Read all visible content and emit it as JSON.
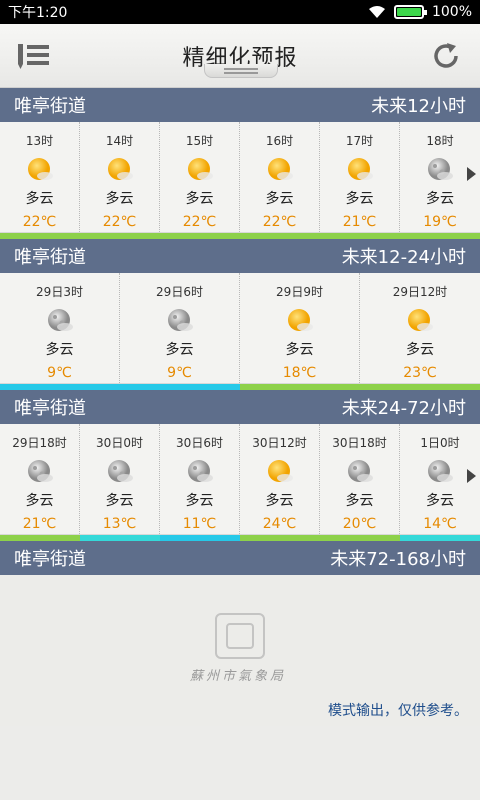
{
  "status_bar": {
    "time": "下午1:20",
    "battery": "100%",
    "battery_level": 1.0
  },
  "header": {
    "title": "精细化预报",
    "menu_icon": "list-menu-icon",
    "refresh_icon": "refresh-icon"
  },
  "sections": [
    {
      "location": "唯亭街道",
      "range": "未来12小时",
      "items": [
        {
          "time": "13时",
          "icon": "sunny-icon",
          "desc": "多云",
          "temp": "22℃"
        },
        {
          "time": "14时",
          "icon": "sunny-icon",
          "desc": "多云",
          "temp": "22℃"
        },
        {
          "time": "15时",
          "icon": "sunny-icon",
          "desc": "多云",
          "temp": "22℃"
        },
        {
          "time": "16时",
          "icon": "sunny-icon",
          "desc": "多云",
          "temp": "22℃"
        },
        {
          "time": "17时",
          "icon": "sunny-icon",
          "desc": "多云",
          "temp": "21℃"
        },
        {
          "time": "18时",
          "icon": "moon-icon",
          "desc": "多云",
          "temp": "19℃"
        }
      ],
      "bar_colors": [
        "#8dd14a",
        "#8dd14a",
        "#8dd14a",
        "#8dd14a",
        "#8dd14a",
        "#8dd14a"
      ]
    },
    {
      "location": "唯亭街道",
      "range": "未来12-24小时",
      "items": [
        {
          "time": "29日3时",
          "icon": "moon-icon",
          "desc": "多云",
          "temp": "9℃"
        },
        {
          "time": "29日6时",
          "icon": "moon-icon",
          "desc": "多云",
          "temp": "9℃"
        },
        {
          "time": "29日9时",
          "icon": "sunny-icon",
          "desc": "多云",
          "temp": "18℃"
        },
        {
          "time": "29日12时",
          "icon": "sunny-icon",
          "desc": "多云",
          "temp": "23℃"
        }
      ],
      "bar_colors": [
        "#26c9e8",
        "#26c9e8",
        "#8dd14a",
        "#8dd14a"
      ]
    },
    {
      "location": "唯亭街道",
      "range": "未来24-72小时",
      "items": [
        {
          "time": "29日18时",
          "icon": "moon-icon",
          "desc": "多云",
          "temp": "21℃"
        },
        {
          "time": "30日0时",
          "icon": "moon-icon",
          "desc": "多云",
          "temp": "13℃"
        },
        {
          "time": "30日6时",
          "icon": "moon-icon",
          "desc": "多云",
          "temp": "11℃"
        },
        {
          "time": "30日12时",
          "icon": "sunny-icon",
          "desc": "多云",
          "temp": "24℃"
        },
        {
          "time": "30日18时",
          "icon": "moon-icon",
          "desc": "多云",
          "temp": "20℃"
        },
        {
          "time": "1日0时",
          "icon": "moon-icon",
          "desc": "多云",
          "temp": "14℃"
        }
      ],
      "bar_colors": [
        "#8dd14a",
        "#35d9d9",
        "#26c9e8",
        "#8dd14a",
        "#8dd14a",
        "#35d9d9"
      ]
    },
    {
      "location": "唯亭街道",
      "range": "未来72-168小时"
    }
  ],
  "footer": {
    "logo_text": "蘇州市氣象局",
    "disclaimer": "模式输出，仅供参考。"
  }
}
